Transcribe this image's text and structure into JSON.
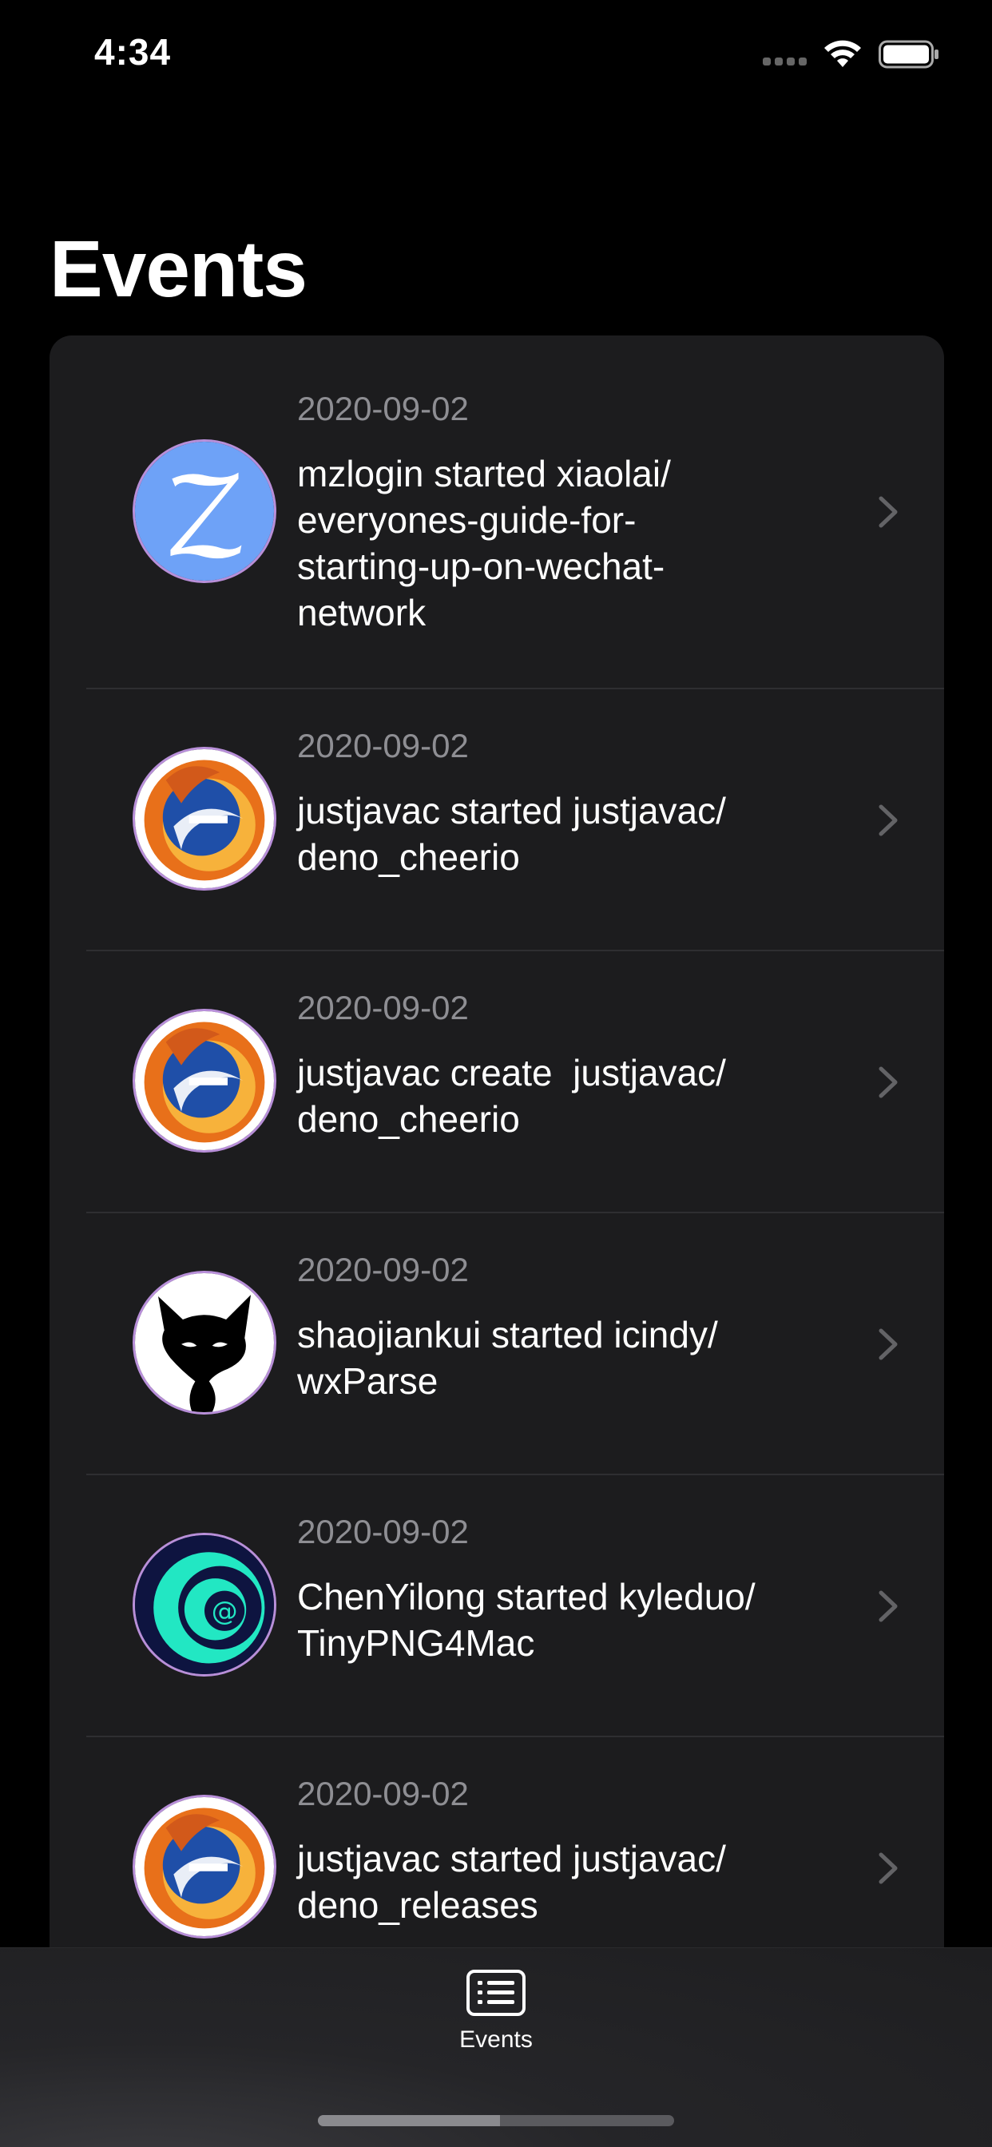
{
  "status_bar": {
    "time": "4:34"
  },
  "header": {
    "title": "Events"
  },
  "events": [
    {
      "date": "2020-09-02",
      "text": "mzlogin started xiaolai/\neveryones-guide-for-\nstarting-up-on-wechat-\nnetwork",
      "avatar": "z-letter-avatar"
    },
    {
      "date": "2020-09-02",
      "text": "justjavac started justjavac/\ndeno_cheerio",
      "avatar": "firefox-ie-avatar"
    },
    {
      "date": "2020-09-02",
      "text": "justjavac create  justjavac/\ndeno_cheerio",
      "avatar": "firefox-ie-avatar"
    },
    {
      "date": "2020-09-02",
      "text": "shaojiankui started icindy/\nwxParse",
      "avatar": "black-fox-avatar"
    },
    {
      "date": "2020-09-02",
      "text": "ChenYilong started kyleduo/\nTinyPNG4Mac",
      "avatar": "teal-at-avatar"
    },
    {
      "date": "2020-09-02",
      "text": "justjavac started justjavac/\ndeno_releases",
      "avatar": "firefox-ie-avatar"
    }
  ],
  "tab_bar": {
    "tabs": [
      {
        "label": "Events",
        "icon": "list-icon"
      }
    ]
  },
  "colors": {
    "background": "#000000",
    "card": "#1c1c1e",
    "secondary_text": "#8e8e93"
  }
}
